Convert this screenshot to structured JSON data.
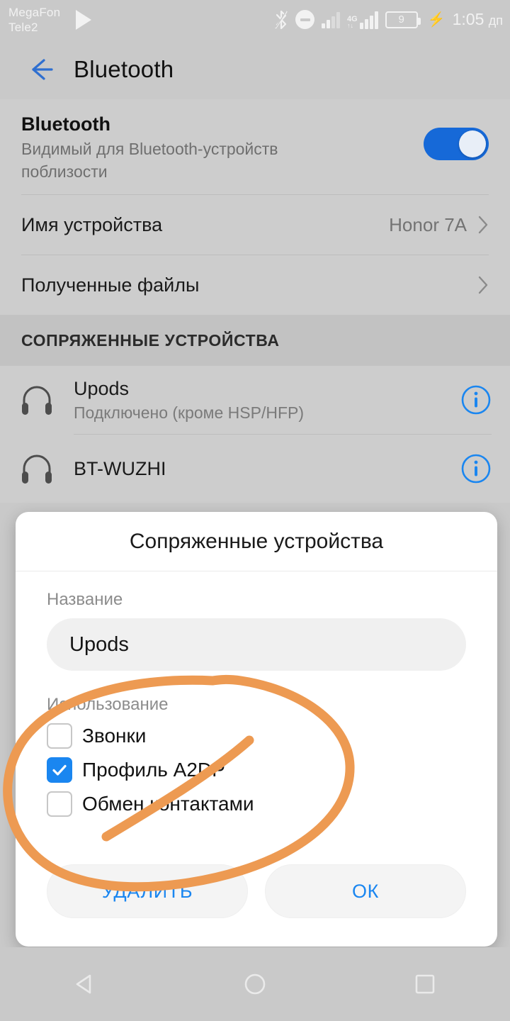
{
  "status_bar": {
    "carrier": "MegaFon\nTele2",
    "icons": [
      "play-icon",
      "bluetooth-icon",
      "do-not-disturb-icon",
      "signal-bars-icon",
      "signal-4g-icon",
      "battery-icon",
      "charging-bolt-icon"
    ],
    "network_type": "4G",
    "battery_level": "9",
    "time": "1:05",
    "time_suffix": "дп"
  },
  "action_bar": {
    "back_icon": "back-arrow-icon",
    "title": "Bluetooth"
  },
  "settings": {
    "bluetooth": {
      "title": "Bluetooth",
      "subtitle": "Видимый для Bluetooth-устройств поблизости",
      "enabled": true,
      "accent": "#1669d8"
    },
    "device_name": {
      "label": "Имя устройства",
      "value": "Honor 7A"
    },
    "received_files": {
      "label": "Полученные файлы",
      "value": ""
    },
    "paired_section_header": "СОПРЯЖЕННЫЕ УСТРОЙСТВА",
    "paired_devices": [
      {
        "name": "Upods",
        "state": "Подключено (кроме HSP/HFP)",
        "icon": "headphones-icon",
        "info_icon": "info-icon"
      },
      {
        "name": "BT-WUZHI",
        "state": "",
        "icon": "headphones-icon",
        "info_icon": "info-icon"
      }
    ]
  },
  "dialog": {
    "title": "Сопряженные устройства",
    "name_label": "Название",
    "name_value": "Upods",
    "usage_label": "Использование",
    "options": [
      {
        "label": "Звонки",
        "checked": false
      },
      {
        "label": "Профиль A2DP",
        "checked": true
      },
      {
        "label": "Обмен контактами",
        "checked": false
      }
    ],
    "delete_button": "УДАЛИТЬ",
    "ok_button": "ОК",
    "checkbox_accent": "#1a86f0",
    "button_text_color": "#1a86f0"
  },
  "annotation": {
    "type": "hand-drawn-circle",
    "color": "#ed9a52"
  },
  "nav_bar": {
    "back": "back-triangle-icon",
    "home": "home-circle-icon",
    "recents": "recents-square-icon"
  }
}
